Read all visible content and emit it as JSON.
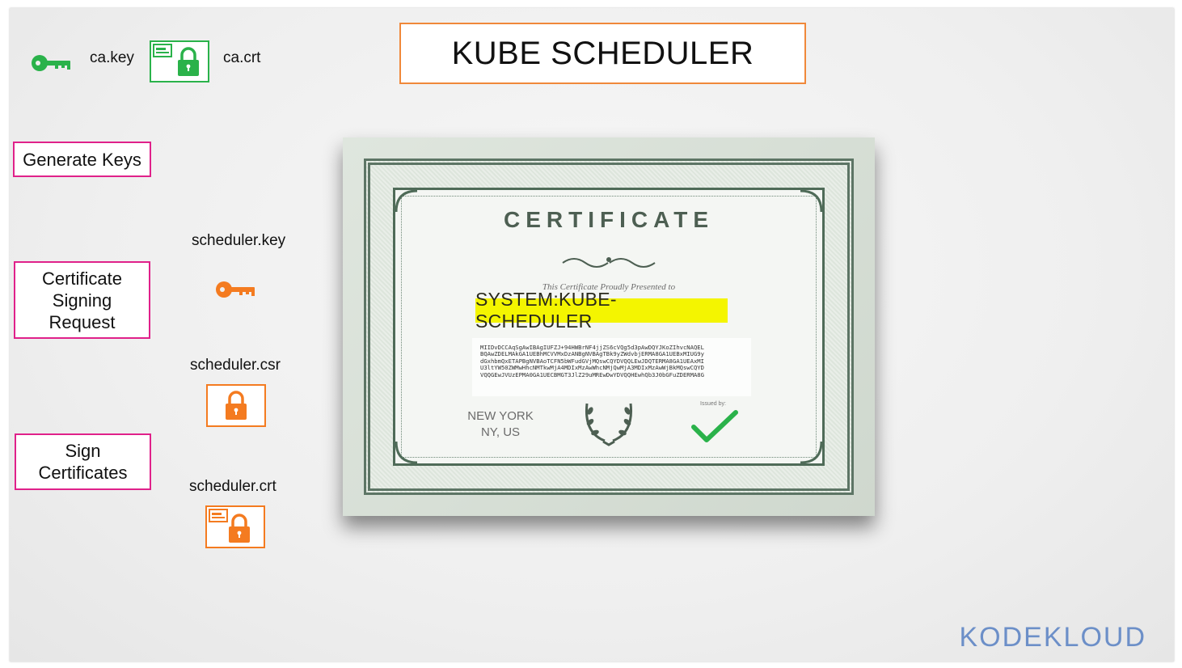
{
  "title": "KUBE SCHEDULER",
  "ca": {
    "key_label": "ca.key",
    "crt_label": "ca.crt"
  },
  "steps": {
    "generate_keys": "Generate Keys",
    "csr_line1": "Certificate",
    "csr_line2": "Signing",
    "csr_line3": "Request",
    "sign_line1": "Sign",
    "sign_line2": "Certificates"
  },
  "files": {
    "key": "scheduler.key",
    "csr": "scheduler.csr",
    "crt": "scheduler.crt"
  },
  "certificate": {
    "heading": "CERTIFICATE",
    "presented": "This Certificate Proudly Presented to",
    "name": "SYSTEM:KUBE-SCHEDULER",
    "key_lines": [
      "MIIDvDCCAqSgAwIBAgIUFZJ+94HWBrNF4jjZS6cVQg5d3pAwDQYJKoZIhvcNAQEL",
      "BQAwZDELMAkGA1UEBhMCVVMxDzANBgNVBAgTBk9yZWdvbjERMA8GA1UEBxMIUG9y",
      "dGxhbmQxETAPBgNVBAoTCFN5bWFudGVjMQswCQYDVQQLEwJDQTERMA8GA1UEAxMI",
      "U3ltYW50ZWMwHhcNMTkwMjA4MDIxMzAwWhcNMjQwMjA3MDIxMzAwWjBkMQswCQYD",
      "VQQGEwJVUzEPMA0GA1UECBMGT3JlZ29uMREwDwYDVQQHEwhQb3J0bGFuZDERMA8G"
    ],
    "city_line1": "NEW YORK",
    "city_line2": "NY, US",
    "issued_by": "Issued by:"
  },
  "brand": "KODEKLOUD",
  "colors": {
    "orange": "#f47b20",
    "green": "#2ab24a",
    "magenta": "#e0218a",
    "highlight": "#f4f500",
    "cert_green": "#4f6b58",
    "brand_blue": "#6c8fc8"
  },
  "icons": [
    "key-icon",
    "certificate-icon",
    "padlock-icon",
    "laurel-icon",
    "checkmark-icon"
  ]
}
